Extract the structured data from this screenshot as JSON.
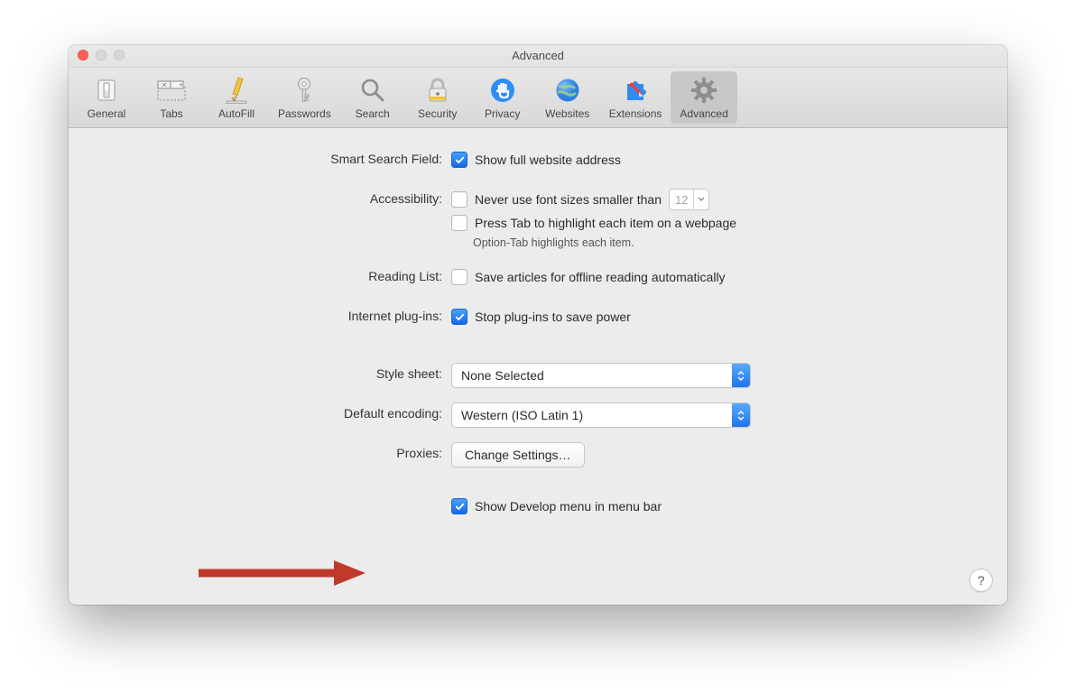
{
  "window": {
    "title": "Advanced"
  },
  "toolbar": {
    "items": [
      {
        "label": "General"
      },
      {
        "label": "Tabs"
      },
      {
        "label": "AutoFill"
      },
      {
        "label": "Passwords"
      },
      {
        "label": "Search"
      },
      {
        "label": "Security"
      },
      {
        "label": "Privacy"
      },
      {
        "label": "Websites"
      },
      {
        "label": "Extensions"
      },
      {
        "label": "Advanced"
      }
    ],
    "active_index": 9
  },
  "sections": {
    "smart_search": {
      "label": "Smart Search Field:",
      "showFullAddress": {
        "checked": true,
        "text": "Show full website address"
      }
    },
    "accessibility": {
      "label": "Accessibility:",
      "minFont": {
        "checked": false,
        "text": "Never use font sizes smaller than",
        "value": "12"
      },
      "tabHighlight": {
        "checked": false,
        "text": "Press Tab to highlight each item on a webpage"
      },
      "hint": "Option-Tab highlights each item."
    },
    "reading_list": {
      "label": "Reading List:",
      "offline": {
        "checked": false,
        "text": "Save articles for offline reading automatically"
      }
    },
    "plugins": {
      "label": "Internet plug-ins:",
      "stop": {
        "checked": true,
        "text": "Stop plug-ins to save power"
      }
    },
    "stylesheet": {
      "label": "Style sheet:",
      "value": "None Selected"
    },
    "encoding": {
      "label": "Default encoding:",
      "value": "Western (ISO Latin 1)"
    },
    "proxies": {
      "label": "Proxies:",
      "button": "Change Settings…"
    },
    "develop": {
      "checked": true,
      "text": "Show Develop menu in menu bar"
    }
  },
  "help_glyph": "?"
}
